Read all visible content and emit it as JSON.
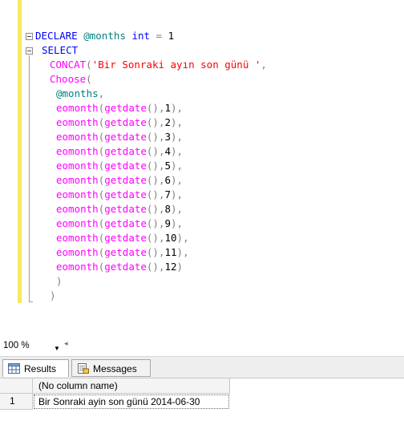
{
  "editor": {
    "lines": [
      [
        {
          "t": "DECLARE ",
          "c": "kw"
        },
        {
          "t": "@months",
          "c": "var"
        },
        {
          "t": " ",
          "c": "plain"
        },
        {
          "t": "int",
          "c": "kw"
        },
        {
          "t": " = ",
          "c": "op"
        },
        {
          "t": "1",
          "c": "num"
        }
      ],
      [
        {
          "t": "SELECT",
          "c": "kw"
        }
      ],
      [
        {
          "t": "CONCAT",
          "c": "fn"
        },
        {
          "t": "(",
          "c": "op"
        },
        {
          "t": "'Bir Sonraki ayın son günü '",
          "c": "str"
        },
        {
          "t": ",",
          "c": "op"
        }
      ],
      [
        {
          "t": "Choose",
          "c": "fn"
        },
        {
          "t": "(",
          "c": "op"
        }
      ],
      [
        {
          "t": "@months",
          "c": "var"
        },
        {
          "t": ",",
          "c": "op"
        }
      ],
      [
        {
          "t": "eomonth",
          "c": "fn"
        },
        {
          "t": "(",
          "c": "op"
        },
        {
          "t": "getdate",
          "c": "fn"
        },
        {
          "t": "(),",
          "c": "op"
        },
        {
          "t": "1",
          "c": "num"
        },
        {
          "t": "),",
          "c": "op"
        }
      ],
      [
        {
          "t": "eomonth",
          "c": "fn"
        },
        {
          "t": "(",
          "c": "op"
        },
        {
          "t": "getdate",
          "c": "fn"
        },
        {
          "t": "(),",
          "c": "op"
        },
        {
          "t": "2",
          "c": "num"
        },
        {
          "t": "),",
          "c": "op"
        }
      ],
      [
        {
          "t": "eomonth",
          "c": "fn"
        },
        {
          "t": "(",
          "c": "op"
        },
        {
          "t": "getdate",
          "c": "fn"
        },
        {
          "t": "(),",
          "c": "op"
        },
        {
          "t": "3",
          "c": "num"
        },
        {
          "t": "),",
          "c": "op"
        }
      ],
      [
        {
          "t": "eomonth",
          "c": "fn"
        },
        {
          "t": "(",
          "c": "op"
        },
        {
          "t": "getdate",
          "c": "fn"
        },
        {
          "t": "(),",
          "c": "op"
        },
        {
          "t": "4",
          "c": "num"
        },
        {
          "t": "),",
          "c": "op"
        }
      ],
      [
        {
          "t": "eomonth",
          "c": "fn"
        },
        {
          "t": "(",
          "c": "op"
        },
        {
          "t": "getdate",
          "c": "fn"
        },
        {
          "t": "(),",
          "c": "op"
        },
        {
          "t": "5",
          "c": "num"
        },
        {
          "t": "),",
          "c": "op"
        }
      ],
      [
        {
          "t": "eomonth",
          "c": "fn"
        },
        {
          "t": "(",
          "c": "op"
        },
        {
          "t": "getdate",
          "c": "fn"
        },
        {
          "t": "(),",
          "c": "op"
        },
        {
          "t": "6",
          "c": "num"
        },
        {
          "t": "),",
          "c": "op"
        }
      ],
      [
        {
          "t": "eomonth",
          "c": "fn"
        },
        {
          "t": "(",
          "c": "op"
        },
        {
          "t": "getdate",
          "c": "fn"
        },
        {
          "t": "(),",
          "c": "op"
        },
        {
          "t": "7",
          "c": "num"
        },
        {
          "t": "),",
          "c": "op"
        }
      ],
      [
        {
          "t": "eomonth",
          "c": "fn"
        },
        {
          "t": "(",
          "c": "op"
        },
        {
          "t": "getdate",
          "c": "fn"
        },
        {
          "t": "(),",
          "c": "op"
        },
        {
          "t": "8",
          "c": "num"
        },
        {
          "t": "),",
          "c": "op"
        }
      ],
      [
        {
          "t": "eomonth",
          "c": "fn"
        },
        {
          "t": "(",
          "c": "op"
        },
        {
          "t": "getdate",
          "c": "fn"
        },
        {
          "t": "(),",
          "c": "op"
        },
        {
          "t": "9",
          "c": "num"
        },
        {
          "t": "),",
          "c": "op"
        }
      ],
      [
        {
          "t": "eomonth",
          "c": "fn"
        },
        {
          "t": "(",
          "c": "op"
        },
        {
          "t": "getdate",
          "c": "fn"
        },
        {
          "t": "(),",
          "c": "op"
        },
        {
          "t": "10",
          "c": "num"
        },
        {
          "t": "),",
          "c": "op"
        }
      ],
      [
        {
          "t": "eomonth",
          "c": "fn"
        },
        {
          "t": "(",
          "c": "op"
        },
        {
          "t": "getdate",
          "c": "fn"
        },
        {
          "t": "(),",
          "c": "op"
        },
        {
          "t": "11",
          "c": "num"
        },
        {
          "t": "),",
          "c": "op"
        }
      ],
      [
        {
          "t": "eomonth",
          "c": "fn"
        },
        {
          "t": "(",
          "c": "op"
        },
        {
          "t": "getdate",
          "c": "fn"
        },
        {
          "t": "(),",
          "c": "op"
        },
        {
          "t": "12",
          "c": "num"
        },
        {
          "t": ")",
          "c": "op"
        }
      ],
      [
        {
          "t": ")",
          "c": "op"
        }
      ],
      [
        {
          "t": ")",
          "c": "op"
        }
      ]
    ]
  },
  "toolbar": {
    "zoom": "100 %",
    "zoom_icon": "chevron-down-icon",
    "scroll_icon": "scroll-left-icon"
  },
  "results": {
    "tabs": [
      {
        "label": "Results",
        "icon": "grid-icon",
        "active": true
      },
      {
        "label": "Messages",
        "icon": "messages-icon",
        "active": false
      }
    ],
    "columns": [
      "(No column name)"
    ],
    "rows": [
      {
        "num": "1",
        "cells": [
          "Bir Sonraki ayin son günü 2014-06-30"
        ]
      }
    ]
  },
  "colors": {
    "keyword": "#0000ff",
    "variable": "#008080",
    "function": "#ff00ff",
    "string": "#ff0000",
    "operator": "#808080",
    "margin_highlight": "#f7e95f"
  }
}
